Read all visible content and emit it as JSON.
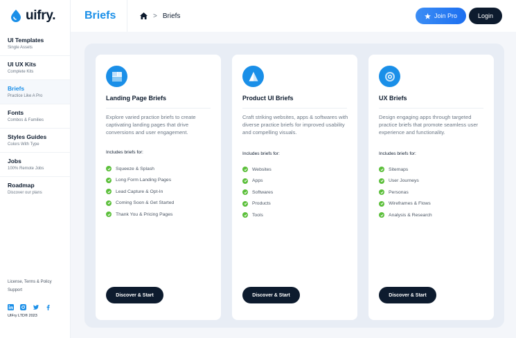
{
  "brand": {
    "name": "uifry.",
    "accent": "#1a8fe8",
    "dark": "#0d1b2e",
    "check_color": "#5bbf3a"
  },
  "header": {
    "page_title": "Briefs",
    "breadcrumb": {
      "home_icon": "home-icon",
      "separator": ">",
      "current": "Briefs"
    },
    "join_label": "Join Pro",
    "login_label": "Login"
  },
  "sidebar": {
    "items": [
      {
        "title": "UI Templates",
        "subtitle": "Single Assets"
      },
      {
        "title": "UI UX Kits",
        "subtitle": "Complete Kits"
      },
      {
        "title": "Briefs",
        "subtitle": "Practice Like A Pro",
        "active": true
      },
      {
        "title": "Fonts",
        "subtitle": "Combos & Families"
      },
      {
        "title": "Styles Guides",
        "subtitle": "Colors With Type"
      },
      {
        "title": "Jobs",
        "subtitle": "100% Remote Jobs"
      },
      {
        "title": "Roadmap",
        "subtitle": "Discover our plans"
      }
    ],
    "footer": {
      "license": "License, Terms & Policy",
      "support": "Support",
      "social_icons": [
        "linkedin-icon",
        "instagram-icon",
        "twitter-icon",
        "facebook-icon"
      ],
      "copyright": "UIFry LTD® 2023"
    }
  },
  "cards": [
    {
      "icon": "landing-page-icon",
      "title": "Landing Page Briefs",
      "description": "Explore varied practice briefs to create captivating landing pages that drive conversions and user engagement.",
      "includes_label": "Includes briefs for:",
      "items": [
        "Squeeze & Splash",
        "Long Form Landing Pages",
        "Lead Capture & Opt-In",
        "Coming Soon & Get Started",
        "Thank You & Pricing Pages"
      ],
      "cta": "Discover & Start"
    },
    {
      "icon": "product-ui-icon",
      "title": "Product UI Briefs",
      "description": "Craft striking websites, apps & softwares with diverse practice briefs for improved usability and compelling visuals.",
      "includes_label": "Includes briefs for:",
      "items": [
        "Websites",
        "Apps",
        "Softwares",
        "Products",
        "Tools"
      ],
      "cta": "Discover & Start"
    },
    {
      "icon": "ux-target-icon",
      "title": "UX Briefs",
      "description": "Design engaging apps through targeted practice briefs that promote seamless user experience and functionality.",
      "includes_label": "Includes briefs for:",
      "items": [
        "Sitemaps",
        "User Journeys",
        "Personas",
        "Wireframes & Flows",
        "Analysis & Research"
      ],
      "cta": "Discover & Start"
    }
  ]
}
